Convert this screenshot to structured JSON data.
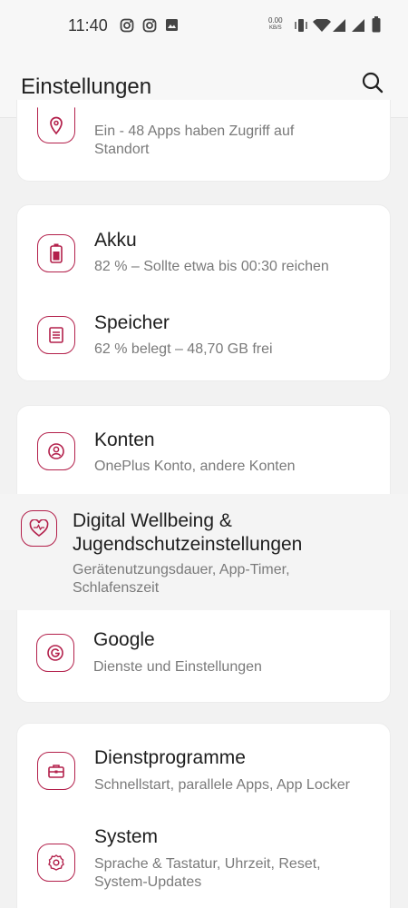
{
  "status_bar": {
    "time": "11:40",
    "net_speed_value": "0.00",
    "net_speed_unit": "KB/S",
    "left_icons": [
      "instagram-icon",
      "instagram-icon",
      "image-icon"
    ],
    "right_icons": [
      "vibrate-icon",
      "wifi-icon",
      "signal-icon",
      "signal-icon",
      "battery-icon"
    ]
  },
  "header": {
    "title": "Einstellungen",
    "search_icon": "search-icon"
  },
  "accent_color": "#b3204b",
  "items": {
    "location": {
      "icon": "location-pin-icon",
      "subtitle_line1": "Ein - 48 Apps haben Zugriff auf",
      "subtitle_line2": "Standort"
    },
    "battery": {
      "icon": "battery-icon",
      "title": "Akku",
      "subtitle": "82 % – Sollte etwa bis 00:30 reichen"
    },
    "storage": {
      "icon": "storage-icon",
      "title": "Speicher",
      "subtitle": "62 % belegt – 48,70 GB frei"
    },
    "accounts": {
      "icon": "account-icon",
      "title": "Konten",
      "subtitle": "OnePlus Konto, andere Konten"
    },
    "wellbeing": {
      "icon": "heart-icon",
      "title_line1": "Digital Wellbeing &",
      "title_line2": "Jugendschutzeinstellungen",
      "subtitle_line1": "Gerätenutzungsdauer, App-Timer,",
      "subtitle_line2": "Schlafenszeit"
    },
    "google": {
      "icon": "google-icon",
      "title": "Google",
      "subtitle": "Dienste und Einstellungen"
    },
    "utilities": {
      "icon": "toolbox-icon",
      "title": "Dienstprogramme",
      "subtitle": "Schnellstart, parallele Apps, App Locker"
    },
    "system": {
      "icon": "gear-icon",
      "title": "System",
      "subtitle_line1": "Sprache & Tastatur, Uhrzeit, Reset,",
      "subtitle_line2": "System-Updates"
    }
  }
}
